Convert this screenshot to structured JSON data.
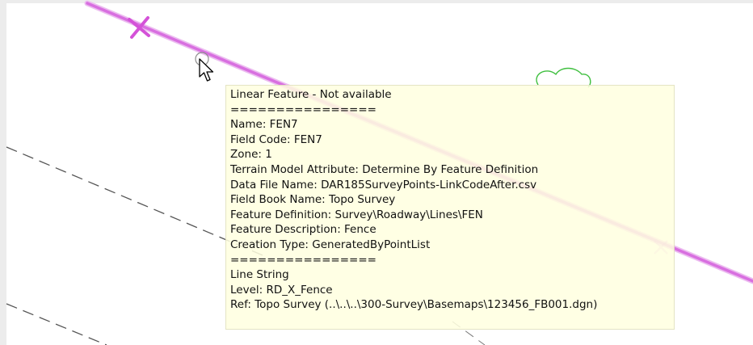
{
  "tooltip": {
    "lines": [
      "Linear Feature - Not available",
      "================",
      "Name: FEN7",
      "Field Code: FEN7",
      "Zone: 1",
      "Terrain Model Attribute: Determine By Feature Definition",
      "Data File Name: DAR185SurveyPoints-LinkCodeAfter.csv",
      "Field Book Name: Topo Survey",
      "Feature Definition: Survey\\Roadway\\Lines\\FEN",
      "Feature Description: Fence",
      "Creation Type: GeneratedByPointList",
      "================",
      "Line String",
      "Level: RD_X_Fence",
      "Ref: Topo Survey (..\\..\\..\\300-Survey\\Basemaps\\123456_FB001.dgn)"
    ]
  },
  "colors": {
    "fence_line": "#d86fe0",
    "fence_marker": "#d452d8",
    "dashed_lines": "#555555",
    "tree_symbol": "#3fbf3f",
    "tooltip_background": "#ffffdf",
    "canvas_background": "#ffffff"
  },
  "icons": {
    "fence_marker": "x-marker-icon",
    "snap_point": "snap-circle-icon",
    "cursor": "arrow-pointer-icon",
    "tree": "tree-cell-icon"
  }
}
